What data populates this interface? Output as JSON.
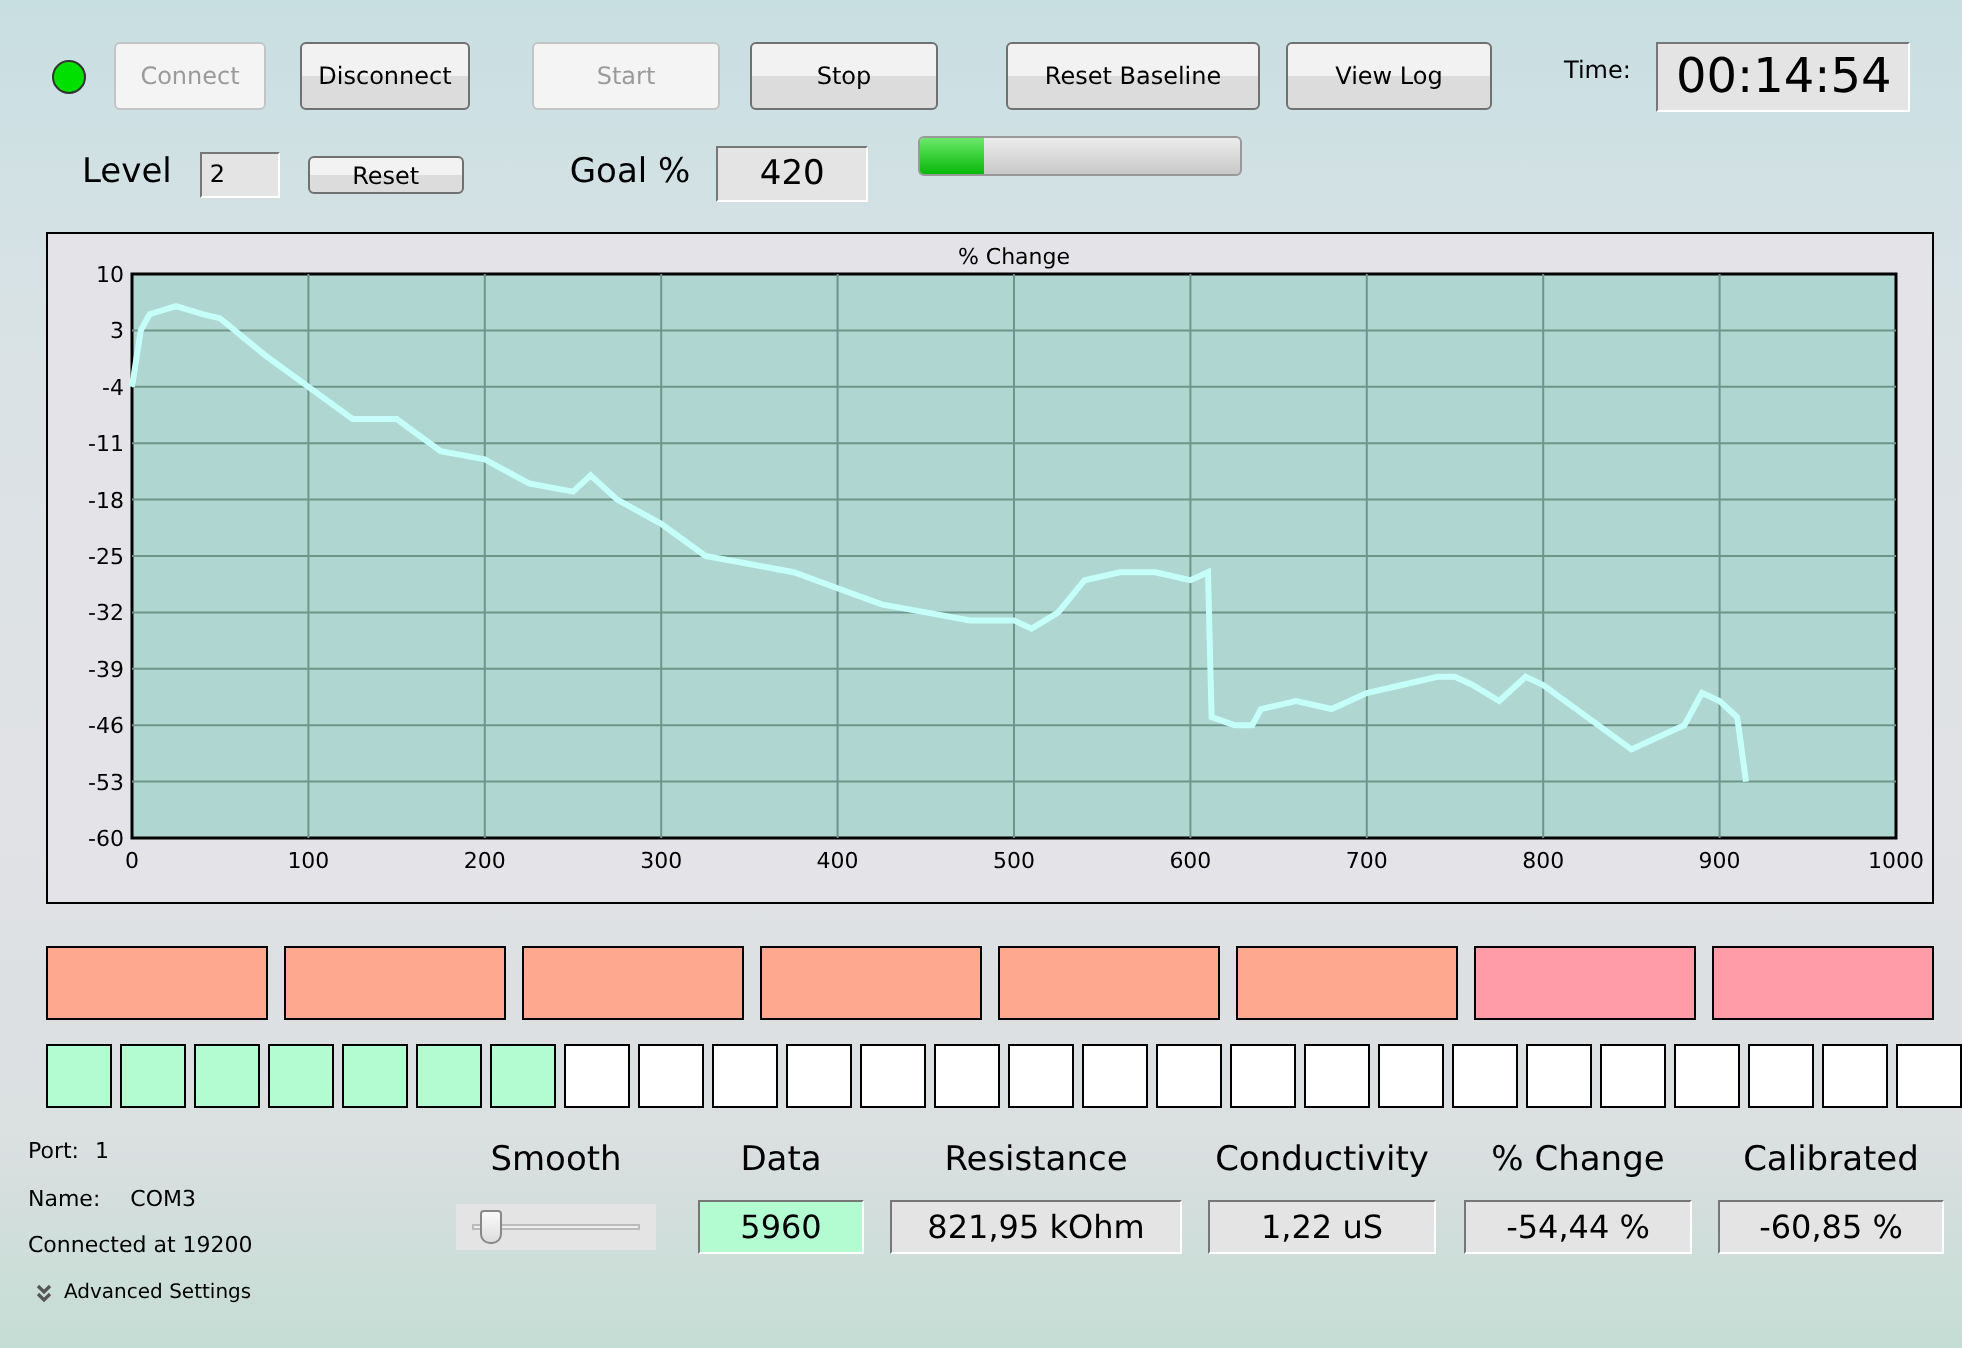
{
  "status_lamp": {
    "on": true
  },
  "top_buttons": [
    {
      "label": "Connect",
      "disabled": true
    },
    {
      "label": "Disconnect",
      "disabled": false
    },
    {
      "label": "Start",
      "disabled": true
    },
    {
      "label": "Stop",
      "disabled": false
    },
    {
      "label": "Reset Baseline",
      "disabled": false
    },
    {
      "label": "View Log",
      "disabled": false
    }
  ],
  "time": {
    "label": "Time:",
    "value": "00:14:54"
  },
  "level": {
    "label": "Level",
    "value": "2",
    "reset_button": "Reset"
  },
  "goal": {
    "label": "Goal %",
    "value": "420"
  },
  "goal_progress": {
    "level": 0.2
  },
  "chart": {
    "chart_data": {
      "type": "line",
      "title": "% Change",
      "xlim": [
        0,
        1000
      ],
      "ylim": [
        -60,
        10
      ],
      "xticks": [
        0,
        100,
        200,
        300,
        400,
        500,
        600,
        700,
        800,
        900,
        1000
      ],
      "yticks": [
        10,
        3,
        -4,
        -11,
        -18,
        -25,
        -32,
        -39,
        -46,
        -53,
        -60
      ],
      "x": [
        0,
        5,
        10,
        25,
        40,
        50,
        75,
        100,
        125,
        150,
        175,
        200,
        225,
        250,
        260,
        275,
        300,
        325,
        350,
        375,
        400,
        425,
        450,
        475,
        500,
        510,
        525,
        540,
        560,
        580,
        600,
        610,
        612,
        625,
        635,
        640,
        660,
        680,
        700,
        720,
        740,
        750,
        760,
        775,
        790,
        800,
        825,
        850,
        870,
        880,
        890,
        900,
        910,
        915
      ],
      "grid": true,
      "series": [
        {
          "color": "#c4fff9",
          "values": [
            -4,
            3,
            5,
            6,
            5,
            4.5,
            0,
            -4,
            -8,
            -8,
            -12,
            -13,
            -16,
            -17,
            -15,
            -18,
            -21,
            -25,
            -26,
            -27,
            -29,
            -31,
            -32,
            -33,
            -33,
            -34,
            -32,
            -28,
            -27,
            -27,
            -28,
            -27,
            -45,
            -46,
            -46,
            -44,
            -43,
            -44,
            -42,
            -41,
            -40,
            -40,
            -41,
            -43,
            -40,
            -41,
            -45,
            -49,
            -47,
            -46,
            -42,
            -43,
            -45,
            -53
          ]
        }
      ]
    }
  },
  "indicator_blocks": [
    {
      "color": "#ffa890"
    },
    {
      "color": "#ffa890"
    },
    {
      "color": "#ffa890"
    },
    {
      "color": "#ffa890"
    },
    {
      "color": "#ffa890"
    },
    {
      "color": "#ffa890"
    },
    {
      "color": "#ff9ca8"
    },
    {
      "color": "#ff9ca8"
    }
  ],
  "level_squares": [
    {
      "on": true
    },
    {
      "on": true
    },
    {
      "on": true
    },
    {
      "on": true
    },
    {
      "on": true
    },
    {
      "on": true
    },
    {
      "on": true
    },
    {
      "on": false
    },
    {
      "on": false
    },
    {
      "on": false
    },
    {
      "on": false
    },
    {
      "on": false
    },
    {
      "on": false
    },
    {
      "on": false
    },
    {
      "on": false
    },
    {
      "on": false
    },
    {
      "on": false
    },
    {
      "on": false
    },
    {
      "on": false
    },
    {
      "on": false
    },
    {
      "on": false
    },
    {
      "on": false
    },
    {
      "on": false
    },
    {
      "on": false
    },
    {
      "on": false
    },
    {
      "on": false
    }
  ],
  "port_info": [
    {
      "label": "Port:",
      "value": "1"
    },
    {
      "label": "Name:",
      "value": "COM3"
    }
  ],
  "connection_status": "Connected at 19200",
  "advanced_settings": "Advanced Settings",
  "smooth": {
    "label": "Smooth",
    "level": 0.05
  },
  "readouts": [
    {
      "label": "Data",
      "value": "5960",
      "highlighted": true
    },
    {
      "label": "Resistance",
      "value": "821,95 kOhm",
      "highlighted": false
    },
    {
      "label": "Conductivity",
      "value": "1,22 uS",
      "highlighted": false
    },
    {
      "label": "% Change",
      "value": "-54,44 %",
      "highlighted": false
    },
    {
      "label": "Calibrated",
      "value": "-60,85 %",
      "highlighted": false
    }
  ]
}
